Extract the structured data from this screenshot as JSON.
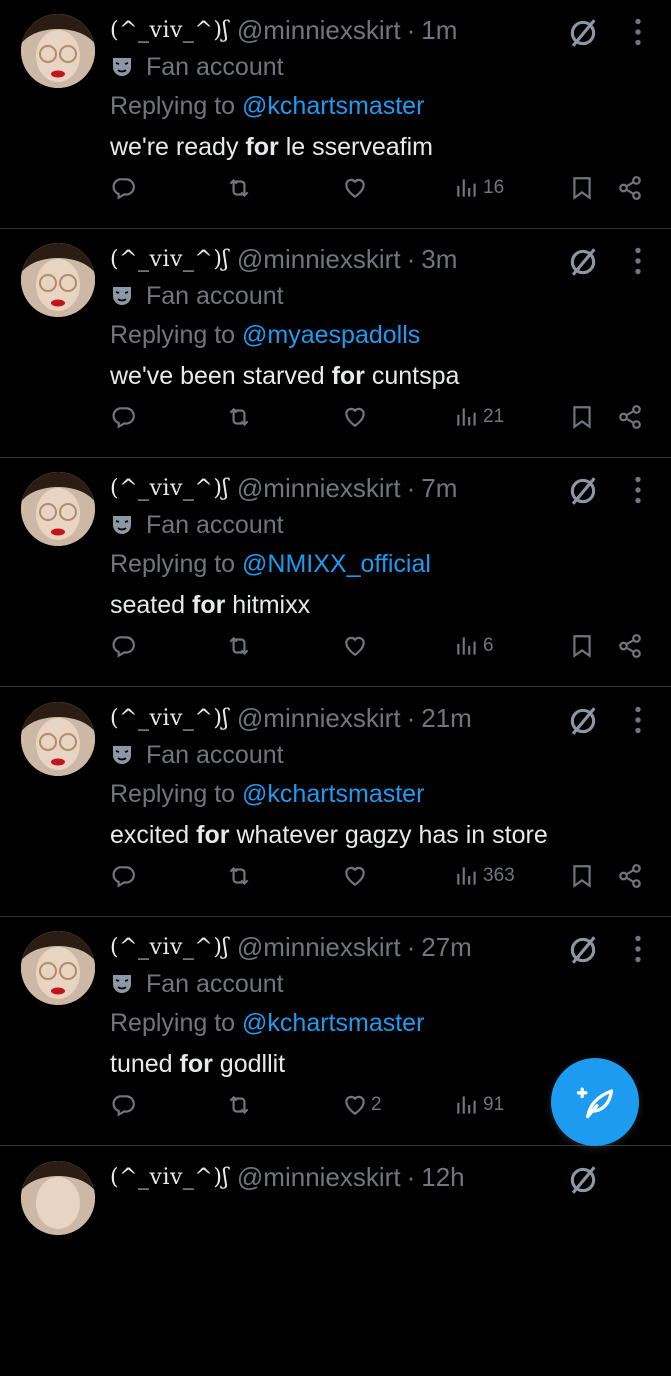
{
  "tweets": [
    {
      "display_name": "(^_viv_^)ʃ",
      "handle": "@minniexskirt",
      "time": "1m",
      "badge": "Fan account",
      "replying_prefix": "Replying to",
      "replying_to": "@kchartsmaster",
      "text_before": "we're ready",
      "text_bold": "for",
      "text_after": "le sserveafim",
      "likes": "",
      "views": "16"
    },
    {
      "display_name": "(^_viv_^)ʃ",
      "handle": "@minniexskirt",
      "time": "3m",
      "badge": "Fan account",
      "replying_prefix": "Replying to",
      "replying_to": "@myaespadolls",
      "text_before": "we've been starved",
      "text_bold": "for",
      "text_after": "cuntspa",
      "likes": "",
      "views": "21"
    },
    {
      "display_name": "(^_viv_^)ʃ",
      "handle": "@minniexskirt",
      "time": "7m",
      "badge": "Fan account",
      "replying_prefix": "Replying to",
      "replying_to": "@NMIXX_official",
      "text_before": "seated",
      "text_bold": "for",
      "text_after": "hitmixx",
      "likes": "",
      "views": "6"
    },
    {
      "display_name": "(^_viv_^)ʃ",
      "handle": "@minniexskirt",
      "time": "21m",
      "badge": "Fan account",
      "replying_prefix": "Replying to",
      "replying_to": "@kchartsmaster",
      "text_before": "excited",
      "text_bold": "for",
      "text_after": "whatever gagzy has in store",
      "likes": "",
      "views": "363"
    },
    {
      "display_name": "(^_viv_^)ʃ",
      "handle": "@minniexskirt",
      "time": "27m",
      "badge": "Fan account",
      "replying_prefix": "Replying to",
      "replying_to": "@kchartsmaster",
      "text_before": "tuned",
      "text_bold": "for",
      "text_after": "godllit",
      "likes": "2",
      "views": "91"
    },
    {
      "display_name": "(^_viv_^)ʃ",
      "handle": "@minniexskirt",
      "time": "12h",
      "badge": "",
      "replying_prefix": "",
      "replying_to": "",
      "text_before": "",
      "text_bold": "",
      "text_after": "",
      "likes": "",
      "views": ""
    }
  ],
  "separator": "·",
  "icons": {
    "reply": "reply-icon",
    "retweet": "retweet-icon",
    "like": "heart-icon",
    "views": "views-icon",
    "bookmark": "bookmark-icon",
    "share": "share-icon",
    "mute": "mute-icon",
    "more": "more-icon",
    "compose": "compose-icon",
    "badge": "mask-icon"
  },
  "colors": {
    "background": "#000000",
    "text": "#e7e9ea",
    "muted": "#71767b",
    "accent": "#1d9bf0",
    "divider": "#2f3336"
  }
}
